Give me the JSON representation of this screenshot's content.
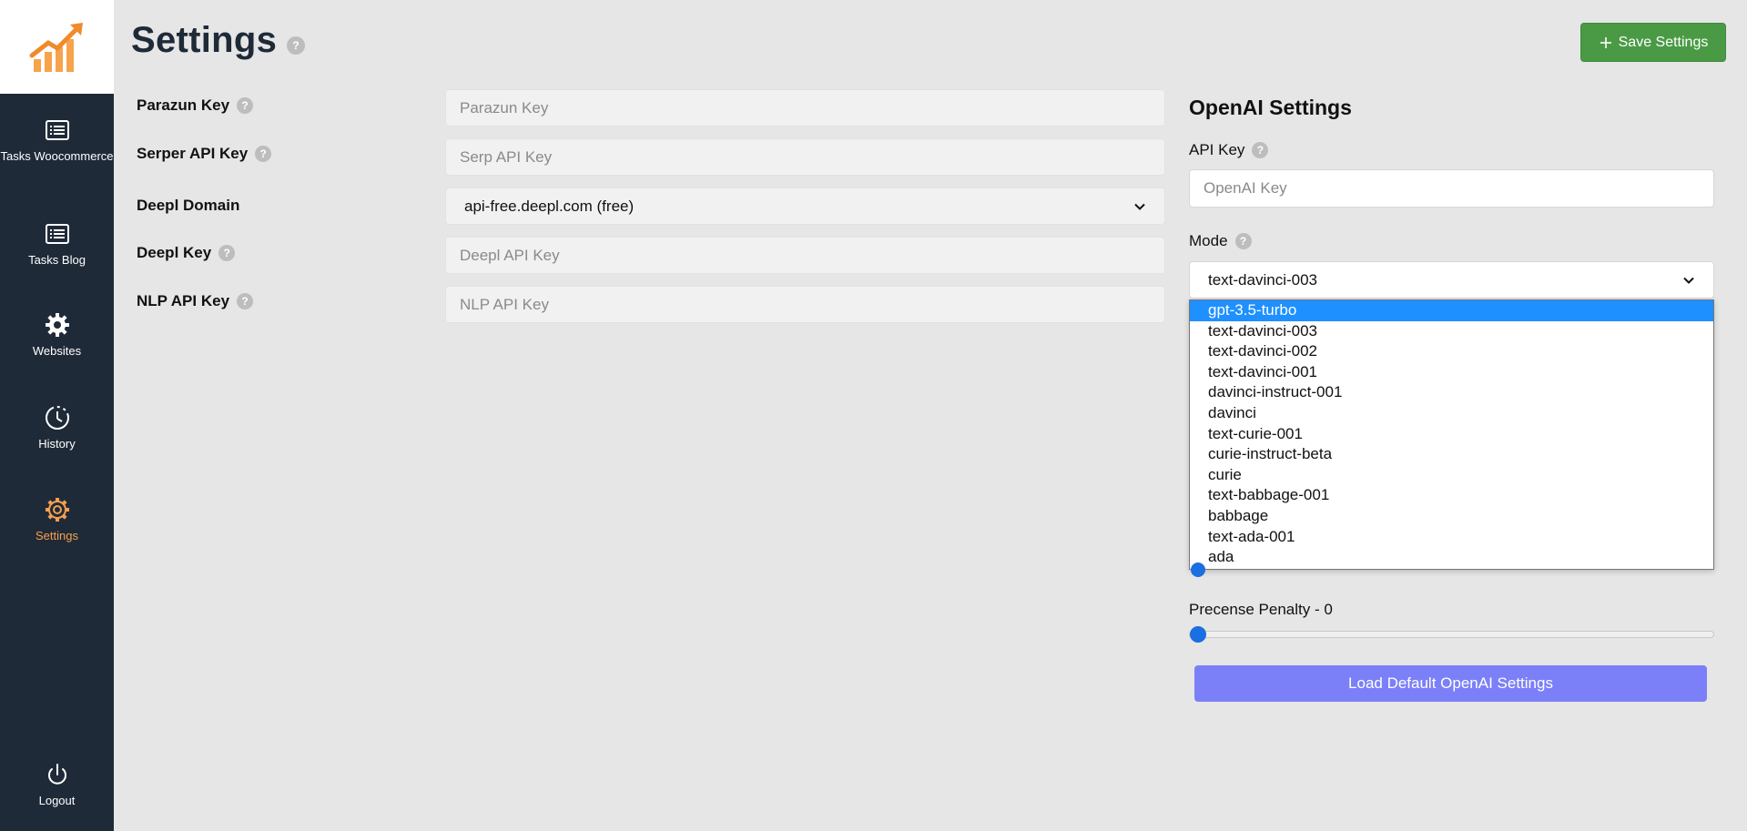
{
  "sidebar": {
    "logo": "chart-growth-logo",
    "items": [
      {
        "label": "Tasks Woocommerce",
        "icon": "list-icon"
      },
      {
        "label": "Tasks Blog",
        "icon": "list-icon"
      },
      {
        "label": "Websites",
        "icon": "gear-icon"
      },
      {
        "label": "History",
        "icon": "clock-history-icon"
      },
      {
        "label": "Settings",
        "icon": "settings-cog-icon",
        "active": true
      }
    ],
    "logout": {
      "label": "Logout",
      "icon": "power-icon"
    }
  },
  "header": {
    "title": "Settings",
    "help": "?",
    "save_label": "Save Settings",
    "save_icon": "plus-icon"
  },
  "form": {
    "parazun": {
      "label": "Parazun Key",
      "placeholder": "Parazun Key",
      "value": ""
    },
    "serper": {
      "label": "Serper API Key",
      "placeholder": "Serp API Key",
      "value": ""
    },
    "deepl_domain": {
      "label": "Deepl Domain",
      "value": "api-free.deepl.com (free)"
    },
    "deepl_key": {
      "label": "Deepl Key",
      "placeholder": "Deepl API Key",
      "value": ""
    },
    "nlp": {
      "label": "NLP API Key",
      "placeholder": "NLP API Key",
      "value": ""
    }
  },
  "openai": {
    "title": "OpenAI Settings",
    "api_key_label": "API Key",
    "api_key_placeholder": "OpenAI Key",
    "mode_label": "Mode",
    "mode_value": "text-davinci-003",
    "mode_options": [
      "gpt-3.5-turbo",
      "text-davinci-003",
      "text-davinci-002",
      "text-davinci-001",
      "davinci-instruct-001",
      "davinci",
      "text-curie-001",
      "curie-instruct-beta",
      "curie",
      "text-babbage-001",
      "babbage",
      "text-ada-001",
      "ada"
    ],
    "highlighted_option": "gpt-3.5-turbo",
    "presence_label": "Precense Penalty - 0",
    "presence_value": 0,
    "load_default_label": "Load Default OpenAI Settings"
  },
  "colors": {
    "sidebar_bg": "#1f2a38",
    "accent_active": "#f5a04c",
    "save_button": "#4a9a45",
    "load_button": "#7b80f8",
    "highlight": "#1e90ff"
  }
}
